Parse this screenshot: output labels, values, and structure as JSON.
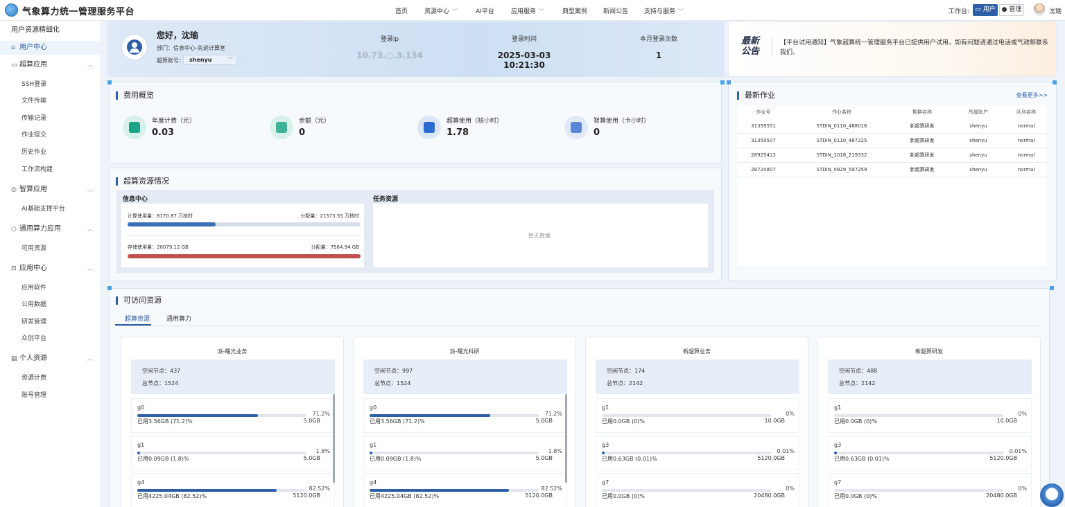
{
  "header": {
    "app_title": "气象算力统一管理服务平台",
    "nav": [
      {
        "label": "首页",
        "has_menu": false
      },
      {
        "label": "资源中心",
        "has_menu": true
      },
      {
        "label": "AI平台",
        "has_menu": false
      },
      {
        "label": "应用服务",
        "has_menu": true
      },
      {
        "label": "典型案例",
        "has_menu": false
      },
      {
        "label": "新闻公告",
        "has_menu": false
      },
      {
        "label": "支持与服务",
        "has_menu": true
      }
    ],
    "workspace_label": "工作台:",
    "user_button": "用户",
    "admin_button": "管理",
    "username": "沈瑜"
  },
  "sidebar": {
    "top_item": "用户资源精细化",
    "items": [
      {
        "type": "group",
        "label": "用户中心",
        "icon": "home-icon",
        "active": true,
        "chevron": false
      },
      {
        "type": "group",
        "label": "超算应用",
        "icon": "monitor-icon",
        "chevron": true
      },
      {
        "type": "sub",
        "label": "SSH登录"
      },
      {
        "type": "sub",
        "label": "文件传输"
      },
      {
        "type": "sub",
        "label": "传输记录"
      },
      {
        "type": "sub",
        "label": "作业提交"
      },
      {
        "type": "sub",
        "label": "历史作业"
      },
      {
        "type": "sub",
        "label": "工作流构建"
      },
      {
        "type": "group",
        "label": "智算应用",
        "icon": "globe-icon",
        "chevron": true
      },
      {
        "type": "sub",
        "label": "AI基础支撑平台"
      },
      {
        "type": "group",
        "label": "通用算力应用",
        "icon": "circle-icon",
        "chevron": true
      },
      {
        "type": "sub",
        "label": "可用资源"
      },
      {
        "type": "group",
        "label": "应用中心",
        "icon": "bag-icon",
        "chevron": true
      },
      {
        "type": "sub",
        "label": "应用软件"
      },
      {
        "type": "sub",
        "label": "公用数据"
      },
      {
        "type": "sub",
        "label": "研发管理"
      },
      {
        "type": "sub",
        "label": "众创平台"
      },
      {
        "type": "group",
        "label": "个人资源",
        "icon": "card-icon",
        "chevron": true
      },
      {
        "type": "sub",
        "label": "资源计费"
      },
      {
        "type": "sub",
        "label": "账号管理"
      }
    ]
  },
  "welcome": {
    "greeting": "您好，沈瑜",
    "dept": "部门：信息中心-先进计算室",
    "account_label": "超算账号：",
    "account_value": "shenyu",
    "login_ip_label": "登录ip",
    "login_ip_value": "10.73.○.3.134",
    "login_time_label": "登录时间",
    "login_time_value": "2025-03-03 10:21:30",
    "monthly_logins_label": "本月登录次数",
    "monthly_logins_value": "1"
  },
  "notice": {
    "title": "最新公告",
    "text": "【平台试用通知】气象超算统一管理服务平台已提供用户试用，如有问题请通过电话或气政邮联系我们。"
  },
  "cost": {
    "title": "费用概览",
    "stats": [
      {
        "label": "年度计费（元）",
        "value": "0.03",
        "icon": "upload-icon",
        "color": "#1fa386",
        "bg": "#d7f0ea"
      },
      {
        "label": "余额（元）",
        "value": "0",
        "icon": "wallet-icon",
        "color": "#3fb39a",
        "bg": "#d9f1ea"
      },
      {
        "label": "超算使用（核小时）",
        "value": "1.78",
        "icon": "cloud-icon",
        "color": "#2e6bd0",
        "bg": "#dbe6f7"
      },
      {
        "label": "智算使用（卡小时）",
        "value": "0",
        "icon": "cube-icon",
        "color": "#5a87d6",
        "bg": "#e1e9f7"
      }
    ]
  },
  "jobs": {
    "title": "最新作业",
    "more": "查看更多>>",
    "columns": [
      "作业号",
      "作业名称",
      "集群名称",
      "所属账户",
      "队列名称"
    ],
    "rows": [
      [
        "31359551",
        "STDIN_0110_488016",
        "新超算研发",
        "shenyu",
        "normal"
      ],
      [
        "31359507",
        "STDIN_0110_487225",
        "新超算研发",
        "shenyu",
        "normal"
      ],
      [
        "28925413",
        "STDIN_1018_219332",
        "新超算研发",
        "shenyu",
        "normal"
      ],
      [
        "28724807",
        "STDIN_0929_597259",
        "新超算研发",
        "shenyu",
        "normal"
      ]
    ]
  },
  "super_resources": {
    "title": "超算资源情况",
    "info_center_label": "信息中心",
    "task_resources_label": "任务资源",
    "compute_used": "计算使用量：8170.87 万核时",
    "compute_alloc": "分配量：21573.55 万核时",
    "compute_ratio": 0.379,
    "storage_used": "存储使用量：20079.12 GB",
    "storage_alloc": "分配量：7564.94 GB",
    "storage_ratio": 1.0,
    "empty": "暂无数据",
    "compute_color": "#3b6fb6",
    "storage_color": "#c0504d"
  },
  "access": {
    "title": "可访问资源",
    "tabs": [
      {
        "label": "超算资源",
        "active": true
      },
      {
        "label": "通用算力",
        "active": false
      }
    ],
    "cards": [
      {
        "name": "派-曙光业务",
        "idle": "空闲节点：437",
        "total": "总节点：1524",
        "scroll": true,
        "items": [
          {
            "name": "g0",
            "pct_label": "71.2%",
            "ratio": 0.712,
            "used": "已用3.56GB (71.2)%",
            "total": "5.0GB"
          },
          {
            "name": "g1",
            "pct_label": "1.8%",
            "ratio": 0.018,
            "used": "已用0.09GB (1.8)%",
            "total": "5.0GB"
          },
          {
            "name": "g4",
            "pct_label": "82.52%",
            "ratio": 0.8252,
            "used": "已用4225.04GB (82.52)%",
            "total": "5120.0GB"
          }
        ]
      },
      {
        "name": "派-曙光科研",
        "idle": "空闲节点：997",
        "total": "总节点：1524",
        "scroll": true,
        "items": [
          {
            "name": "g0",
            "pct_label": "71.2%",
            "ratio": 0.712,
            "used": "已用3.56GB (71.2)%",
            "total": "5.0GB"
          },
          {
            "name": "g1",
            "pct_label": "1.8%",
            "ratio": 0.018,
            "used": "已用0.09GB (1.8)%",
            "total": "5.0GB"
          },
          {
            "name": "g4",
            "pct_label": "82.52%",
            "ratio": 0.8252,
            "used": "已用4225.04GB (82.52)%",
            "total": "5120.0GB"
          }
        ]
      },
      {
        "name": "新超算业务",
        "idle": "空闲节点：174",
        "total": "总节点：2142",
        "scroll": false,
        "items": [
          {
            "name": "g1",
            "pct_label": "0%",
            "ratio": 0,
            "used": "已用0.0GB (0)%",
            "total": "10.0GB"
          },
          {
            "name": "g3",
            "pct_label": "0.01%",
            "ratio": 0.0001,
            "used": "已用0.63GB (0.01)%",
            "total": "5120.0GB"
          },
          {
            "name": "g7",
            "pct_label": "0%",
            "ratio": 0,
            "used": "已用0.0GB (0)%",
            "total": "20480.0GB"
          }
        ]
      },
      {
        "name": "新超算研发",
        "idle": "空闲节点：488",
        "total": "总节点：2142",
        "scroll": false,
        "items": [
          {
            "name": "g1",
            "pct_label": "0%",
            "ratio": 0,
            "used": "已用0.0GB (0)%",
            "total": "10.0GB"
          },
          {
            "name": "g3",
            "pct_label": "0.01%",
            "ratio": 0.0001,
            "used": "已用0.63GB (0.01)%",
            "total": "5120.0GB"
          },
          {
            "name": "g7",
            "pct_label": "0%",
            "ratio": 0,
            "used": "已用0.0GB (0)%",
            "total": "20480.0GB"
          }
        ]
      }
    ]
  }
}
